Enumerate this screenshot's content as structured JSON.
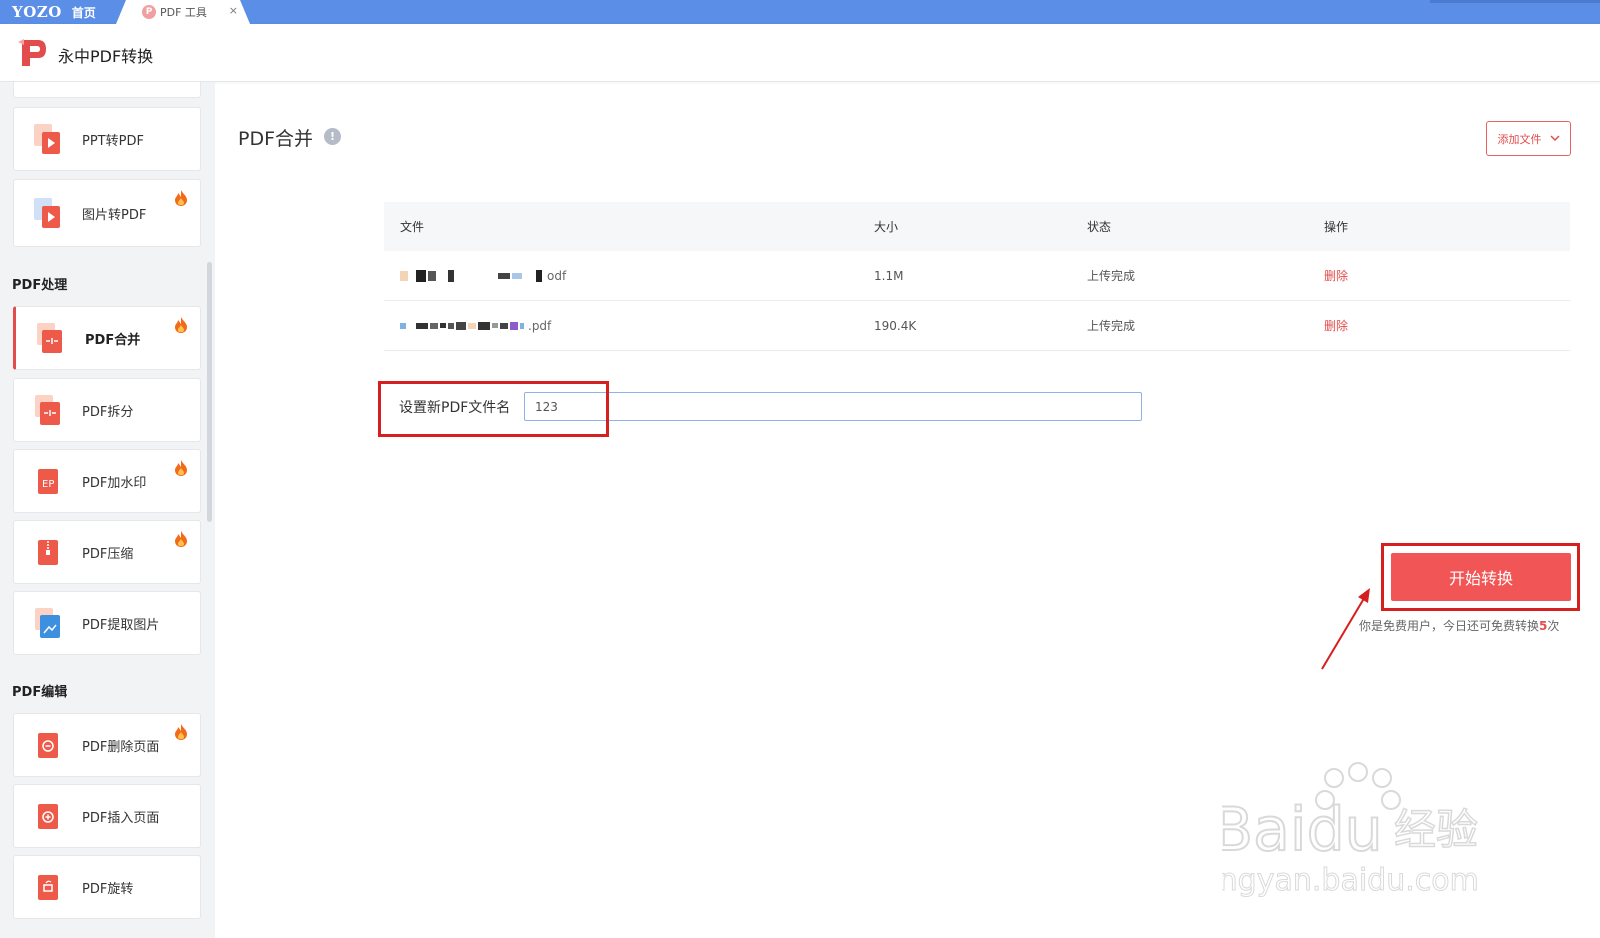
{
  "tabbar": {
    "brand": "YOZO",
    "home_label": "首页",
    "active_tab_icon": "P",
    "active_tab_label": "PDF 工具",
    "close": "×"
  },
  "header": {
    "title": "永中PDF转换"
  },
  "sidebar": {
    "top_cards": [
      {
        "label": "PPT转PDF",
        "hot": false
      },
      {
        "label": "图片转PDF",
        "hot": true
      }
    ],
    "sections": [
      {
        "title": "PDF处理",
        "items": [
          {
            "label": "PDF合并",
            "hot": true,
            "active": true
          },
          {
            "label": "PDF拆分",
            "hot": false
          },
          {
            "label": "PDF加水印",
            "hot": true
          },
          {
            "label": "PDF压缩",
            "hot": true
          },
          {
            "label": "PDF提取图片",
            "hot": false
          }
        ]
      },
      {
        "title": "PDF编辑",
        "items": [
          {
            "label": "PDF删除页面",
            "hot": true
          },
          {
            "label": "PDF插入页面",
            "hot": false
          },
          {
            "label": "PDF旋转",
            "hot": false
          }
        ]
      }
    ]
  },
  "main": {
    "title": "PDF合并",
    "info_icon": "!",
    "add_file_label": "添加文件",
    "table": {
      "headers": {
        "file": "文件",
        "size": "大小",
        "status": "状态",
        "action": "操作"
      },
      "rows": [
        {
          "file_suffix": "odf",
          "size": "1.1M",
          "status": "上传完成",
          "action": "删除"
        },
        {
          "file_suffix": ".pdf",
          "size": "190.4K",
          "status": "上传完成",
          "action": "删除"
        }
      ]
    },
    "name_label": "设置新PDF文件名",
    "name_value": "123",
    "start_button": "开始转换",
    "quota_prefix": "你是免费用户，今日还可免费转换",
    "quota_count": "5",
    "quota_suffix": "次"
  },
  "watermark": {
    "text_main": "Baidu",
    "text_cn": "经验",
    "url": "jingyan.baidu.com"
  },
  "colors": {
    "accent": "#e24c4c",
    "tabbar": "#5b8ee6",
    "annotation": "#d61f1f"
  }
}
